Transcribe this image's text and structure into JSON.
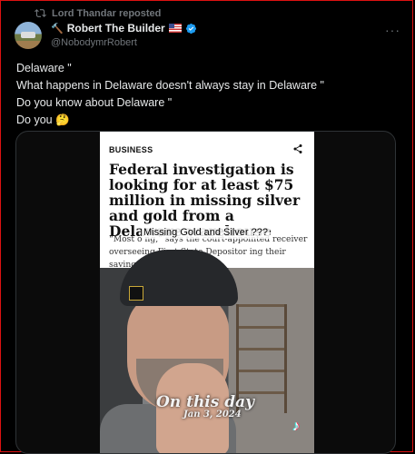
{
  "repost": {
    "icon": "repost-icon",
    "label": "Lord Thandar reposted"
  },
  "author": {
    "name": "Robert The Builder",
    "prefix_emoji": "🔨",
    "flag": "us-flag-icon",
    "verified": true,
    "handle": "@NobodymrRobert"
  },
  "more_label": "···",
  "tweet": {
    "lines": [
      "Delaware \"",
      "What happens in Delaware doesn't always stay in Delaware \"",
      "Do you know about Delaware \"",
      "Do you 🤔"
    ]
  },
  "media": {
    "section": "BUSINESS",
    "headline": "Federal investigation is looking for at least $75 million in missing silver and gold from a Delaware warehouse",
    "body": "“Most o            ng,” says the court-appointed receiver overseeing First State Depositor          ing their savings. It’s tragic.",
    "overlay_caption": "Missing Gold and Silver ???",
    "on_this_day": "On this day",
    "date": "Jan 3, 2024",
    "watermark_icon": "tiktok-icon"
  },
  "colors": {
    "accent_blue": "#1d9bf0",
    "muted": "#71767b",
    "frame_red": "#dd1111"
  }
}
